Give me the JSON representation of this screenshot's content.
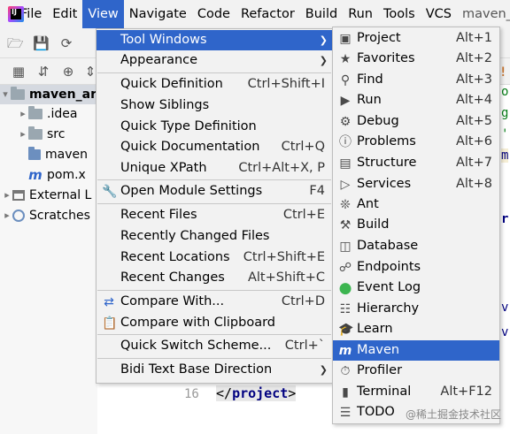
{
  "menubar": {
    "items": [
      "File",
      "Edit",
      "View",
      "Navigate",
      "Code",
      "Refactor",
      "Build",
      "Run",
      "Tools",
      "VCS"
    ],
    "project_title": "maven_"
  },
  "tree": {
    "root": "maven_ar",
    "idea": ".idea",
    "src": "src",
    "maven_file": "maven",
    "pom": "pom.x",
    "external": "External L",
    "scratches": "Scratches"
  },
  "view_menu": {
    "items": [
      {
        "label": "Tool Windows",
        "shortcut": "",
        "submenu": true
      },
      {
        "label": "Appearance",
        "shortcut": "",
        "submenu": true
      },
      {
        "label": "Quick Definition",
        "shortcut": "Ctrl+Shift+I"
      },
      {
        "label": "Show Siblings",
        "shortcut": ""
      },
      {
        "label": "Quick Type Definition",
        "shortcut": ""
      },
      {
        "label": "Quick Documentation",
        "shortcut": "Ctrl+Q"
      },
      {
        "label": "Unique XPath",
        "shortcut": "Ctrl+Alt+X, P"
      },
      {
        "label": "Open Module Settings",
        "shortcut": "F4"
      },
      {
        "label": "Recent Files",
        "shortcut": "Ctrl+E"
      },
      {
        "label": "Recently Changed Files",
        "shortcut": ""
      },
      {
        "label": "Recent Locations",
        "shortcut": "Ctrl+Shift+E"
      },
      {
        "label": "Recent Changes",
        "shortcut": "Alt+Shift+C"
      },
      {
        "label": "Compare With...",
        "shortcut": "Ctrl+D"
      },
      {
        "label": "Compare with Clipboard",
        "shortcut": ""
      },
      {
        "label": "Quick Switch Scheme...",
        "shortcut": "Ctrl+`"
      },
      {
        "label": "Bidi Text Base Direction",
        "shortcut": "",
        "submenu": true
      }
    ]
  },
  "tool_windows_menu": {
    "items": [
      {
        "label": "Project",
        "shortcut": "Alt+1"
      },
      {
        "label": "Favorites",
        "shortcut": "Alt+2"
      },
      {
        "label": "Find",
        "shortcut": "Alt+3"
      },
      {
        "label": "Run",
        "shortcut": "Alt+4"
      },
      {
        "label": "Debug",
        "shortcut": "Alt+5"
      },
      {
        "label": "Problems",
        "shortcut": "Alt+6"
      },
      {
        "label": "Structure",
        "shortcut": "Alt+7"
      },
      {
        "label": "Services",
        "shortcut": "Alt+8"
      },
      {
        "label": "Ant",
        "shortcut": ""
      },
      {
        "label": "Build",
        "shortcut": ""
      },
      {
        "label": "Database",
        "shortcut": ""
      },
      {
        "label": "Endpoints",
        "shortcut": ""
      },
      {
        "label": "Event Log",
        "shortcut": ""
      },
      {
        "label": "Hierarchy",
        "shortcut": ""
      },
      {
        "label": "Learn",
        "shortcut": ""
      },
      {
        "label": "Maven",
        "shortcut": ""
      },
      {
        "label": "Profiler",
        "shortcut": ""
      },
      {
        "label": "Terminal",
        "shortcut": "Alt+F12"
      },
      {
        "label": "TODO",
        "shortcut": ""
      }
    ]
  },
  "editor": {
    "line_number": "16",
    "line_open": "</",
    "line_tag": "project",
    "line_close": ">"
  },
  "watermark": "@稀土掘金技术社区",
  "colors": {
    "highlight": "#2f65ca",
    "menu_bg": "#f2f2f2",
    "event_log": "#3cb550"
  }
}
